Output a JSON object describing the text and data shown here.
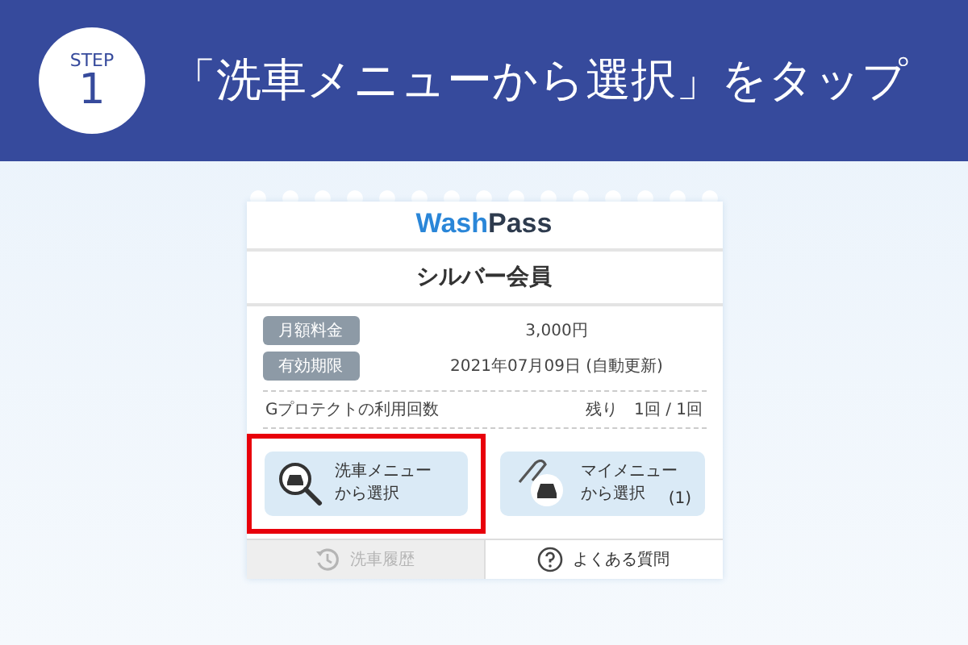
{
  "header": {
    "step_label": "STEP",
    "step_number": "1",
    "title": "「洗車メニューから選択」をタップ"
  },
  "app": {
    "logo": {
      "first": "Wash",
      "second": "Pass"
    },
    "plan": "シルバー会員",
    "info_rows": [
      {
        "label": "月額料金",
        "value": "3,000円"
      },
      {
        "label": "有効期限",
        "value": "2021年07月09日 (自動更新)"
      }
    ],
    "usage": {
      "label": "Gプロテクトの利用回数",
      "value": "残り　1回 / 1回"
    },
    "menu_buttons": [
      {
        "kind": "search",
        "line1": "洗車メニュー",
        "line2": "から選択",
        "highlighted": true
      },
      {
        "kind": "clip",
        "line1": "マイメニュー",
        "line2": "から選択",
        "count": "(1)",
        "highlighted": false
      }
    ],
    "footer_tabs": [
      {
        "kind": "history",
        "label": "洗車履歴",
        "disabled": true
      },
      {
        "kind": "faq",
        "label": "よくある質問",
        "disabled": false
      }
    ]
  }
}
